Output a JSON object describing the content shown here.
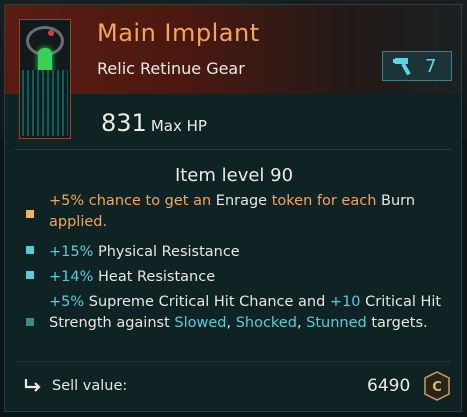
{
  "item": {
    "name": "Main Implant",
    "type": "Relic Retinue Gear",
    "level_badge": "7",
    "hp_value": "831",
    "hp_label": "Max HP",
    "item_level": "Item level 90"
  },
  "stats": [
    {
      "bullet_color": "#f0b64a",
      "parts": [
        {
          "text": "+5%",
          "style": "orange"
        },
        {
          "text": " chance to get an ",
          "style": "orange"
        },
        {
          "text": "Enrage",
          "style": "white"
        },
        {
          "text": " token for each ",
          "style": "orange"
        },
        {
          "text": "Burn",
          "style": "white"
        },
        {
          "text": " applied.",
          "style": "orange"
        }
      ]
    },
    {
      "bullet_color": "#4fd0de",
      "parts": [
        {
          "text": "+15%",
          "style": "cyan"
        },
        {
          "text": " Physical Resistance",
          "style": "white"
        }
      ]
    },
    {
      "bullet_color": "#4fd0de",
      "parts": [
        {
          "text": "+14%",
          "style": "cyan"
        },
        {
          "text": " Heat Resistance",
          "style": "white"
        }
      ]
    },
    {
      "bullet_color": "#3a8c8a",
      "parts": [
        {
          "text": "+5%",
          "style": "cyan"
        },
        {
          "text": " Supreme Critical Hit Chance and ",
          "style": "white"
        },
        {
          "text": "+10",
          "style": "cyan"
        },
        {
          "text": " Critical Hit Strength against ",
          "style": "white"
        },
        {
          "text": "Slowed",
          "style": "cyan"
        },
        {
          "text": ", ",
          "style": "white"
        },
        {
          "text": "Shocked",
          "style": "cyan"
        },
        {
          "text": ", ",
          "style": "white"
        },
        {
          "text": "Stunned",
          "style": "cyan"
        },
        {
          "text": " targets.",
          "style": "white"
        }
      ]
    }
  ],
  "sell": {
    "label": "Sell value:",
    "value": "6490",
    "currency_icon": "credit-coin-icon",
    "currency_letter": "C"
  },
  "colors": {
    "title": "#f2a65a",
    "accent_cyan": "#4fd0de",
    "panel_bg": "#0f2224"
  }
}
